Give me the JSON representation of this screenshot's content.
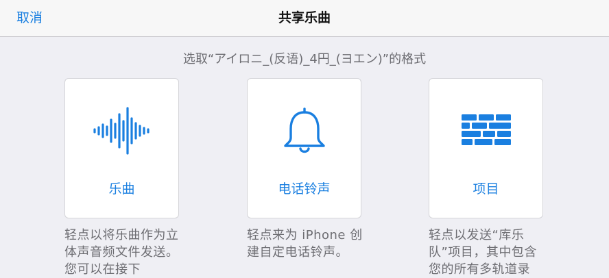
{
  "navbar": {
    "cancel_label": "取消",
    "title": "共享乐曲"
  },
  "subtitle": "选取“アイロニ_(反语)_4円_(ヨエン)”的格式",
  "options": [
    {
      "label": "乐曲",
      "icon": "waveform-icon",
      "description": "轻点以将乐曲作为立体声音频文件发送。您可以在接下"
    },
    {
      "label": "电话铃声",
      "icon": "bell-icon",
      "description": "轻点来为 iPhone 创建自定电话铃声。"
    },
    {
      "label": "项目",
      "icon": "tracks-icon",
      "description": "轻点以发送“库乐队”项目，其中包含您的所有多轨道录"
    }
  ],
  "colors": {
    "accent": "#1a7fe0",
    "background": "#efeff4",
    "navbar": "#f7f7f7",
    "secondary_text": "#6d6d72"
  }
}
